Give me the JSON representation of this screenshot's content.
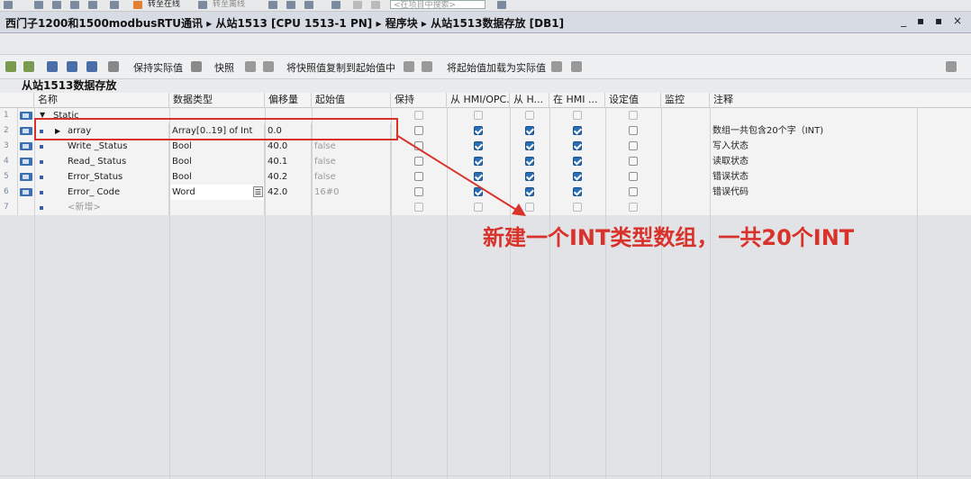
{
  "top_toolbar": {
    "go_online": "转至在线",
    "go_offline": "转至离线",
    "search_placeholder": "<在项目中搜索>"
  },
  "breadcrumb": {
    "project": "西门子1200和1500modbusRTU通讯",
    "sep": "▸",
    "station": "从站1513 [CPU 1513-1 PN]",
    "folder": "程序块",
    "block": "从站1513数据存放 [DB1]"
  },
  "window_buttons": "_ ▪ ▪ ×",
  "editor_toolbar": {
    "keep_actual": "保持实际值",
    "snapshot": "快照",
    "copy_snapshot": "将快照值复制到起始值中",
    "load_start": "将起始值加载为实际值"
  },
  "block_name": "从站1513数据存放",
  "columns": {
    "name": "名称",
    "data_type": "数据类型",
    "offset": "偏移量",
    "start_value": "起始值",
    "retain": "保持",
    "from_hmi_opc": "从 HMI/OPC...",
    "from_h": "从 H...",
    "in_hmi": "在 HMI ...",
    "setpoint": "设定值",
    "monitor": "监控",
    "comment": "注释"
  },
  "rows": [
    {
      "num": "1",
      "name": "Static",
      "type": "",
      "offset": "",
      "start": "",
      "comment": ""
    },
    {
      "num": "2",
      "name": "array",
      "type": "Array[0..19] of Int",
      "offset": "0.0",
      "start": "",
      "comment": "数组一共包含20个字（INT)"
    },
    {
      "num": "3",
      "name": "Write _Status",
      "type": "Bool",
      "offset": "40.0",
      "start": "false",
      "comment": "写入状态"
    },
    {
      "num": "4",
      "name": "Read_ Status",
      "type": "Bool",
      "offset": "40.1",
      "start": "false",
      "comment": "读取状态"
    },
    {
      "num": "5",
      "name": "Error_Status",
      "type": "Bool",
      "offset": "40.2",
      "start": "false",
      "comment": "错误状态"
    },
    {
      "num": "6",
      "name": "Error_ Code",
      "type": "Word",
      "offset": "42.0",
      "start": "16#0",
      "comment": "错误代码"
    },
    {
      "num": "7",
      "name": "<新增>",
      "type": "",
      "offset": "",
      "start": "",
      "comment": ""
    }
  ],
  "annotation": "新建一个INT类型数组，一共20个INT",
  "colors": {
    "annotation_red": "#d9322b",
    "checkbox_blue": "#2a6fb5"
  }
}
